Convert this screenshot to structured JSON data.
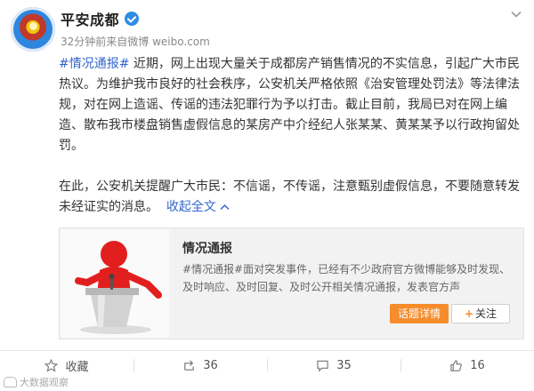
{
  "account": {
    "name": "平安成都",
    "avatar_icon": "police-badge-icon",
    "verified_icon": "verified-icon"
  },
  "meta": {
    "time": "32分钟前",
    "source": "来自微博 weibo.com"
  },
  "post": {
    "hashtag": "#情况通报#",
    "para1": " 近期，网上出现大量关于成都房产销售情况的不实信息，引起广大市民热议。为维护我市良好的社会秩序，公安机关严格依照《治安管理处罚法》等法律法规，对在网上造谣、传谣的违法犯罪行为予以打击。截止目前，我局已对在网上编造、散布我市楼盘销售虚假信息的某房产中介经纪人张某某、黄某某予以行政拘留处罚。",
    "para2": "在此，公安机关提醒广大市民：不信谣，不传谣，注意甄别虚假信息，不要随意转发未经证实的消息。",
    "fold_link": "收起全文",
    "fold_icon": "chevron-up-icon"
  },
  "card": {
    "title": "情况通报",
    "description": "#情况通报#面对突发事件，已经有不少政府官方微博能够及时发现、及时响应、及时回复、及时公开相关情况通报，发表官方声",
    "detail_button": "话题详情",
    "follow_button": "关注"
  },
  "actions": [
    {
      "icon": "star-icon",
      "label": "收藏"
    },
    {
      "icon": "repost-icon",
      "label": "36"
    },
    {
      "icon": "comment-icon",
      "label": "35"
    },
    {
      "icon": "thumbs-up-icon",
      "label": "16"
    }
  ],
  "watermark": "大数据观察",
  "colors": {
    "link": "#3366cc",
    "verified": "#2f8de4",
    "detail_button": "#f68c2c",
    "card_bg": "#f2f2f2"
  }
}
